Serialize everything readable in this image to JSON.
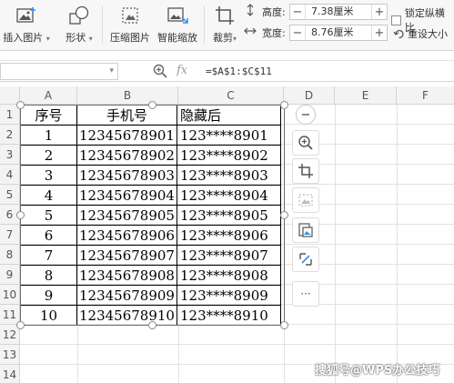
{
  "ribbon": {
    "insert_picture": "插入图片",
    "shape": "形状",
    "compress": "压缩图片",
    "smart_scale": "智能缩放",
    "crop": "裁剪",
    "height_label": "高度:",
    "height_value": "7.38厘米",
    "width_label": "宽度:",
    "width_value": "8.76厘米",
    "lock_ratio": "锁定纵横比",
    "reset_size": "重设大小"
  },
  "formula_bar": {
    "name_box": "",
    "fx": "fx",
    "formula": "=$A$1:$C$11"
  },
  "columns": [
    "A",
    "B",
    "C",
    "D",
    "E",
    "F"
  ],
  "rows": [
    "1",
    "2",
    "3",
    "4",
    "5",
    "6",
    "7",
    "8",
    "9",
    "10",
    "11",
    "12",
    "13",
    "14"
  ],
  "table": {
    "headers": [
      "序号",
      "手机号",
      "隐藏后"
    ],
    "rows": [
      [
        "1",
        "12345678901",
        "123****8901"
      ],
      [
        "2",
        "12345678902",
        "123****8902"
      ],
      [
        "3",
        "12345678903",
        "123****8903"
      ],
      [
        "4",
        "12345678904",
        "123****8904"
      ],
      [
        "5",
        "12345678905",
        "123****8905"
      ],
      [
        "6",
        "12345678906",
        "123****8906"
      ],
      [
        "7",
        "12345678907",
        "123****8907"
      ],
      [
        "8",
        "12345678908",
        "123****8908"
      ],
      [
        "9",
        "12345678909",
        "123****8909"
      ],
      [
        "10",
        "12345678910",
        "123****8910"
      ]
    ]
  },
  "float_toolbar": {
    "icons": [
      "collapse-icon",
      "zoom-icon",
      "crop-icon",
      "picture-icon",
      "picture-edit-icon",
      "image-convert-icon",
      "more-icon"
    ],
    "more_label": "···"
  },
  "watermark": "搜狐号@WPS办公技巧",
  "colors": {
    "ribbon_bg": "#f7f7f7",
    "header_bg": "#f3f3f3",
    "grid_line": "#e2e2e2",
    "table_border": "#000000"
  }
}
